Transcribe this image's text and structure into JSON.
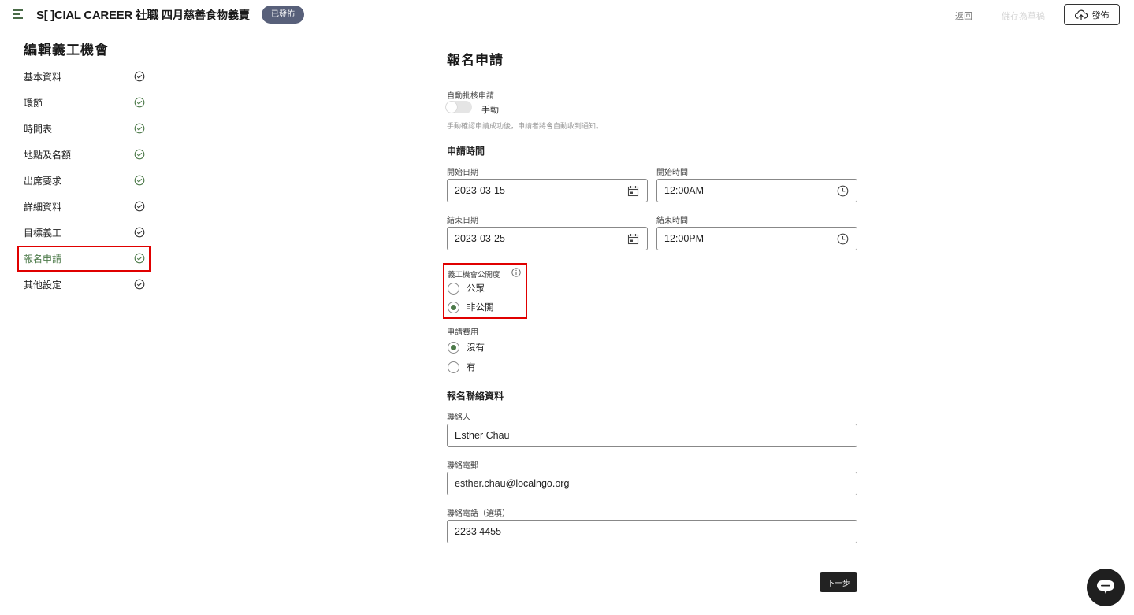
{
  "header": {
    "logo_text": "S[ ]CIAL CAREER 社職",
    "event_title": "四月慈善食物義賣",
    "status_badge": "已發佈",
    "back_label": "返回",
    "save_draft_label": "儲存為草稿",
    "publish_label": "發佈"
  },
  "sidebar": {
    "title": "編輯義工機會",
    "items": [
      {
        "label": "基本資料",
        "status": "neutral"
      },
      {
        "label": "環節",
        "status": "done"
      },
      {
        "label": "時間表",
        "status": "done"
      },
      {
        "label": "地點及名額",
        "status": "done"
      },
      {
        "label": "出席要求",
        "status": "done"
      },
      {
        "label": "詳細資料",
        "status": "neutral"
      },
      {
        "label": "目標義工",
        "status": "neutral"
      },
      {
        "label": "報名申請",
        "status": "active"
      },
      {
        "label": "其他設定",
        "status": "neutral"
      }
    ]
  },
  "form": {
    "section_title": "報名申請",
    "auto_approve": {
      "label": "自動批核申請",
      "toggle_label": "手動",
      "enabled": false,
      "help": "手動確認申請成功後，申請者將會自動收到通知。"
    },
    "period": {
      "title": "申請時間",
      "start_date_label": "開始日期",
      "start_date": "2023-03-15",
      "start_time_label": "開始時間",
      "start_time": "12:00AM",
      "end_date_label": "結束日期",
      "end_date": "2023-03-25",
      "end_time_label": "結束時間",
      "end_time": "12:00PM"
    },
    "visibility": {
      "label": "義工機會公開度",
      "options": [
        {
          "label": "公眾",
          "selected": false
        },
        {
          "label": "非公開",
          "selected": true
        }
      ]
    },
    "fee": {
      "label": "申請費用",
      "options": [
        {
          "label": "沒有",
          "selected": true
        },
        {
          "label": "有",
          "selected": false
        }
      ]
    },
    "contact": {
      "title": "報名聯絡資料",
      "person_label": "聯絡人",
      "person": "Esther Chau",
      "email_label": "聯絡電郵",
      "email": "esther.chau@localngo.org",
      "phone_label": "聯絡電話（選填）",
      "phone": "2233 4455"
    },
    "next_label": "下一步"
  },
  "colors": {
    "accent_green": "#4d7a4a",
    "badge_bg": "#58607a",
    "highlight_red": "#e00000",
    "dark": "#222222"
  }
}
